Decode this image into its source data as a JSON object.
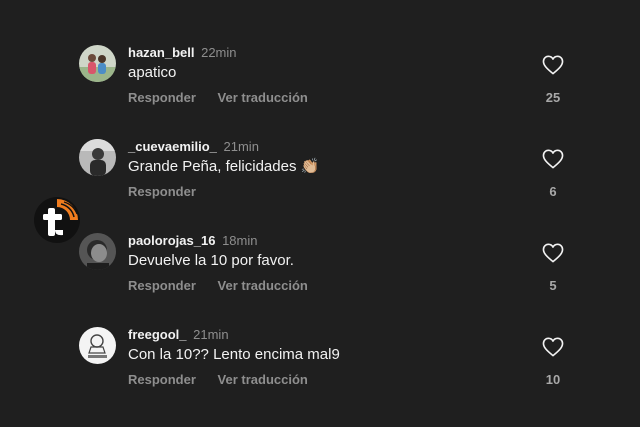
{
  "comments": [
    {
      "username": "hazan_bell",
      "time": "22min",
      "text": "apatico",
      "reply_label": "Responder",
      "translate_label": "Ver traducción",
      "likes": "25"
    },
    {
      "username": "_cuevaemilio_",
      "time": "21min",
      "text": "Grande Peña, felicidades 👏🏼",
      "reply_label": "Responder",
      "likes": "6"
    },
    {
      "username": "paolorojas_16",
      "time": "18min",
      "text": "Devuelve la 10 por favor.",
      "reply_label": "Responder",
      "translate_label": "Ver traducción",
      "likes": "5"
    },
    {
      "username": "freegool_",
      "time": "21min",
      "text": "Con la 10?? Lento encima mal9",
      "reply_label": "Responder",
      "translate_label": "Ver traducción",
      "likes": "10"
    }
  ],
  "icons": {
    "like": "heart-outline-icon",
    "watermark": "t-logo-icon"
  },
  "colors": {
    "background": "#1f1f1f",
    "primary_text": "#f2f2f2",
    "secondary_text": "#8e8e8e",
    "logo_accent": "#f07c1e"
  }
}
